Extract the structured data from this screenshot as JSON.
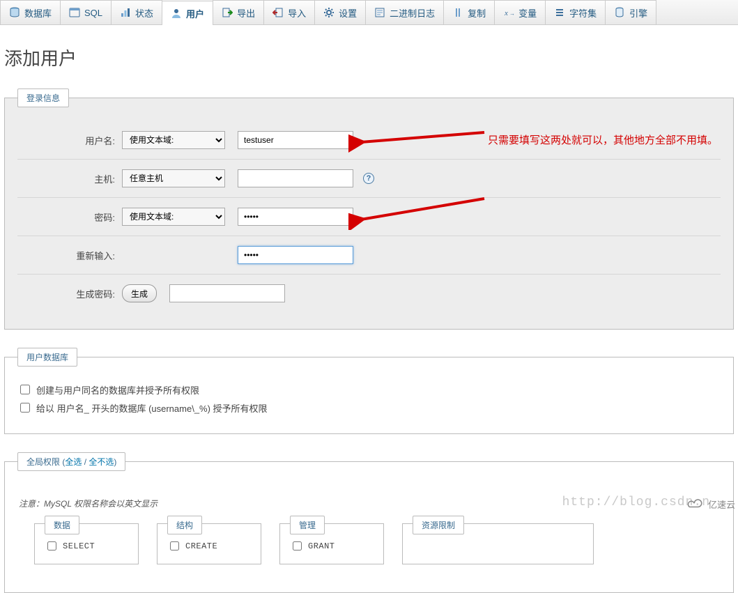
{
  "tabs": [
    {
      "label": "数据库",
      "icon": "db"
    },
    {
      "label": "SQL",
      "icon": "sql"
    },
    {
      "label": "状态",
      "icon": "status"
    },
    {
      "label": "用户",
      "icon": "user"
    },
    {
      "label": "导出",
      "icon": "export"
    },
    {
      "label": "导入",
      "icon": "import"
    },
    {
      "label": "设置",
      "icon": "gear"
    },
    {
      "label": "二进制日志",
      "icon": "binlog"
    },
    {
      "label": "复制",
      "icon": "repl"
    },
    {
      "label": "变量",
      "icon": "vars"
    },
    {
      "label": "字符集",
      "icon": "charset"
    },
    {
      "label": "引擎",
      "icon": "engine"
    }
  ],
  "active_tab_index": 3,
  "page_title": "添加用户",
  "login_section": {
    "legend": "登录信息",
    "rows": {
      "username": {
        "label": "用户名:",
        "select": "使用文本域:",
        "value": "testuser"
      },
      "host": {
        "label": "主机:",
        "select": "任意主机",
        "value": ""
      },
      "password": {
        "label": "密码:",
        "select": "使用文本域:",
        "value": "•••••"
      },
      "retype": {
        "label": "重新输入:",
        "value": "•••••"
      },
      "generate": {
        "label": "生成密码:",
        "button": "生成",
        "value": ""
      }
    }
  },
  "db_section": {
    "legend": "用户数据库",
    "chk1": "创建与用户同名的数据库并授予所有权限",
    "chk2": "给以 用户名_ 开头的数据库 (username\\_%) 授予所有权限"
  },
  "priv_section": {
    "legend_prefix": "全局权限 (",
    "legend_all": "全选",
    "legend_sep": " / ",
    "legend_none": "全不选",
    "legend_suffix": ")",
    "note": "注意：MySQL 权限名称会以英文显示",
    "groups": {
      "data": {
        "legend": "数据",
        "items": [
          "SELECT"
        ]
      },
      "struct": {
        "legend": "结构",
        "items": [
          "CREATE"
        ]
      },
      "admin": {
        "legend": "管理",
        "items": [
          "GRANT"
        ]
      },
      "limits": {
        "legend": "资源限制",
        "items": []
      }
    }
  },
  "annotation_text": "只需要填写这两处就可以，其他地方全部不用填。",
  "watermark_url": "http://blog.csdn.n",
  "watermark_brand": "亿速云"
}
